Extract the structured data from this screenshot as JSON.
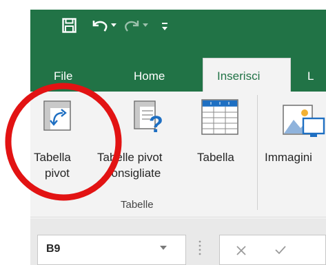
{
  "qat": {
    "save_icon": "save-icon",
    "undo_icon": "undo-icon",
    "redo_icon": "redo-icon",
    "customize_icon": "customize-qat-icon"
  },
  "tabs": {
    "file": "File",
    "home": "Home",
    "insert": "Inserisci",
    "next_partial": "L"
  },
  "ribbon": {
    "buttons": [
      {
        "line1": "Tabella",
        "line2": "pivot",
        "icon": "pivot-table-icon"
      },
      {
        "line1": "Tabelle pivot",
        "line2": "consigliate",
        "icon": "recommended-pivot-icon"
      },
      {
        "line1": "Tabella",
        "line2": "",
        "icon": "table-icon"
      },
      {
        "line1": "Immagini",
        "line2": "",
        "icon": "pictures-icon"
      }
    ],
    "group_label": "Tabelle"
  },
  "formula_bar": {
    "name_box": "B9"
  },
  "colors": {
    "excel_green": "#217346",
    "ribbon_bg": "#f3f3f3",
    "annotation_red": "#e21313"
  }
}
